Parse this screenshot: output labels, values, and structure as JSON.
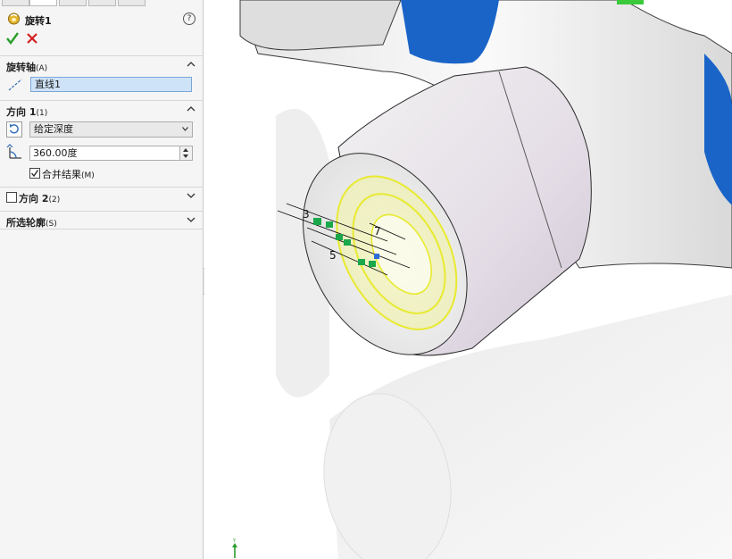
{
  "panel": {
    "feature_title": "旋转1",
    "help_glyph": "?",
    "icons": {
      "feature": "revolve-feature-icon",
      "help": "help-icon",
      "ok": "checkmark-icon",
      "cancel": "close-icon",
      "axis": "axis-line-icon",
      "reverse_direction": "reverse-direction-icon",
      "angle": "angle-icon",
      "collapse": "chevron-up-icon",
      "expand": "chevron-down-icon"
    },
    "colors": {
      "ok": "#2a9d2a",
      "cancel": "#d42020",
      "selection_fill": "#cfe3f8",
      "selection_border": "#7aa7d8"
    },
    "axis_section": {
      "title": "旋转轴",
      "shortcut": "(A)",
      "value": "直线1"
    },
    "direction1": {
      "title": "方向 1",
      "shortcut": "(1)",
      "end_condition": "给定深度",
      "angle": "360.00度",
      "merge_label": "合并结果",
      "merge_shortcut": "(M)",
      "merge_checked": true
    },
    "direction2": {
      "title": "方向 2",
      "shortcut": "(2)",
      "checked": false
    },
    "contours": {
      "title": "所选轮廓",
      "shortcut": "(S)"
    }
  },
  "viewport": {
    "sketch_dimensions": [
      "3",
      "7",
      "5"
    ],
    "triad_label": "Y",
    "colors": {
      "part_blue": "#1a64c8",
      "sketch_yellow": "#e8ea30",
      "sketch_relations": "#1aa84a"
    }
  }
}
